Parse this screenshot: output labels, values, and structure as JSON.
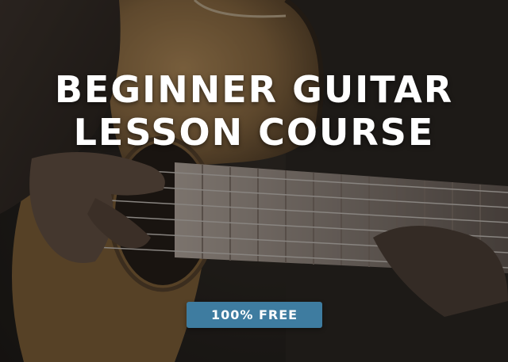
{
  "title": {
    "line1": "BEGINNER GUITAR",
    "line2": "LESSON COURSE"
  },
  "badge": {
    "label": "100% FREE",
    "color": "#3e7ca0"
  },
  "colors": {
    "title_text": "#ffffff",
    "guitar_body": "#9a7444",
    "fretboard": "#b9aaa0"
  }
}
